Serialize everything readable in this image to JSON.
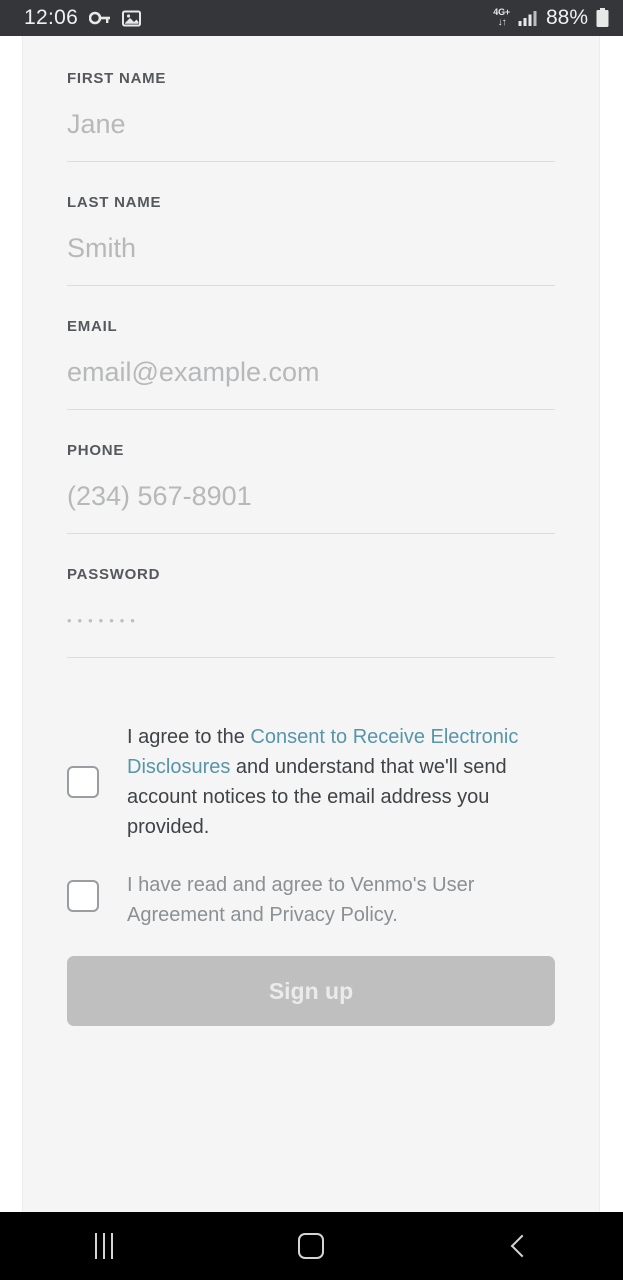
{
  "status_bar": {
    "time": "12:06",
    "icons": [
      "vpn-key-icon",
      "screenshot-image-icon"
    ],
    "network_generation": "4G+",
    "network_arrows": "↓↑",
    "signal": "signal-bars-icon",
    "battery_percent": "88%",
    "battery_icon": "battery-icon",
    "background_color": "#34363a"
  },
  "form": {
    "fields": [
      {
        "label": "FIRST NAME",
        "value": "",
        "placeholder": "Jane",
        "type": "text"
      },
      {
        "label": "LAST NAME",
        "value": "",
        "placeholder": "Smith",
        "type": "text"
      },
      {
        "label": "EMAIL",
        "value": "",
        "placeholder": "email@example.com",
        "type": "email"
      },
      {
        "label": "PHONE",
        "value": "",
        "placeholder": "(234) 567-8901",
        "type": "tel"
      },
      {
        "label": "PASSWORD",
        "value": "",
        "placeholder": "•••••••",
        "type": "password"
      }
    ]
  },
  "consents": {
    "electronic_disclosures": {
      "checked": false,
      "text_before": "I agree to the ",
      "link_text": "Consent to Receive Electronic Disclosures",
      "text_after": " and understand that we'll send account notices to the email address you provided."
    },
    "user_agreement": {
      "checked": false,
      "text": "I have read and agree to Venmo's User Agreement and Privacy Policy."
    }
  },
  "submit": {
    "label": "Sign up",
    "enabled": false,
    "background_color": "#bfbfbf",
    "text_color": "#ebebeb"
  },
  "navigation_bar": {
    "recents_label": "recents-icon",
    "home_label": "home-icon",
    "back_label": "back-icon",
    "background_color": "#000000"
  },
  "theme": {
    "link_color": "#5795ab",
    "page_background": "#f5f5f5",
    "label_color": "#55585c",
    "placeholder_color": "#b6b8ba"
  }
}
